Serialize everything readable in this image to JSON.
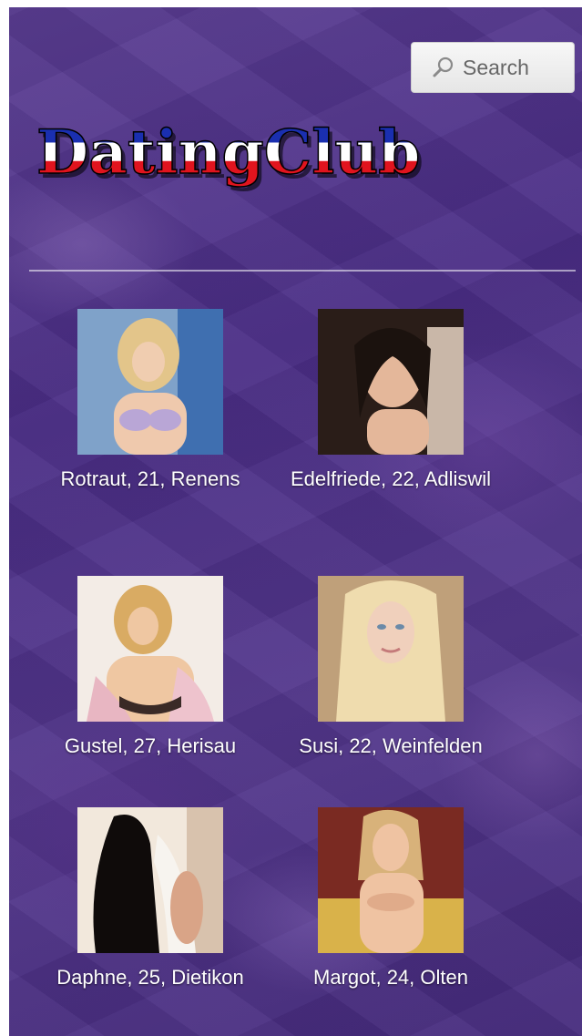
{
  "search": {
    "label": "Search",
    "icon": "search-icon"
  },
  "logo": {
    "text": "DatingClub",
    "colors": [
      "#ffffff",
      "#1a2fb0",
      "#e0141e"
    ]
  },
  "profiles": [
    {
      "caption": "Rotraut, 21, Renens"
    },
    {
      "caption": "Edelfriede, 22, Adliswil"
    },
    {
      "caption": "Gustel, 27, Herisau"
    },
    {
      "caption": "Susi, 22, Weinfelden"
    },
    {
      "caption": "Daphne, 25, Dietikon"
    },
    {
      "caption": "Margot, 24, Olten"
    }
  ]
}
